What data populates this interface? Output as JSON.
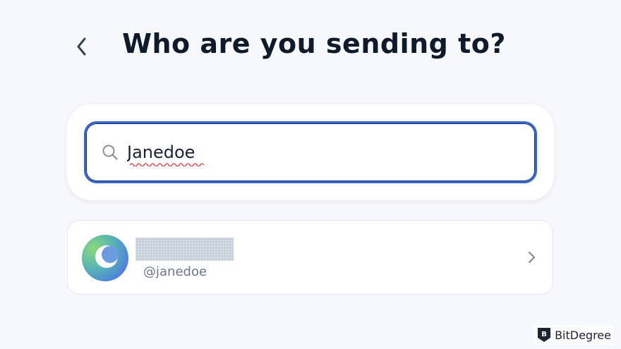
{
  "header": {
    "title": "Who are you sending to?"
  },
  "search": {
    "value": "Janedoe",
    "accent_color": "#3868c9"
  },
  "results": [
    {
      "name_redacted": true,
      "handle": "@janedoe"
    }
  ],
  "icons": {
    "back": "chevron-left-icon",
    "search": "search-icon",
    "open": "chevron-right-icon",
    "watermark": "bitdegree-logo"
  },
  "watermark": {
    "text": "BitDegree"
  }
}
